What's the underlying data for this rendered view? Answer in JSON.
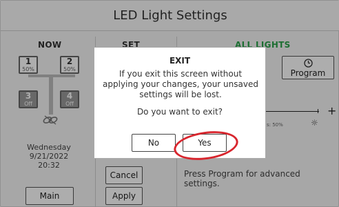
{
  "window": {
    "title": "LED Light Settings"
  },
  "now_panel": {
    "heading": "NOW",
    "lights": [
      {
        "number": "1",
        "status": "50%",
        "state": "on"
      },
      {
        "number": "2",
        "status": "50%",
        "state": "on"
      },
      {
        "number": "3",
        "status": "Off",
        "state": "off"
      },
      {
        "number": "4",
        "status": "Off",
        "state": "off"
      }
    ],
    "date": {
      "weekday": "Wednesday",
      "date": "9/21/2022",
      "time": "20:32"
    },
    "main_button": "Main"
  },
  "set_panel": {
    "heading": "SET",
    "cancel_button": "Cancel",
    "apply_button": "Apply"
  },
  "all_lights_panel": {
    "heading": "ALL LIGHTS",
    "program_button": "Program",
    "brightness_label": "s: 50%",
    "hint": "Press Program for advanced settings."
  },
  "dialog": {
    "title": "EXIT",
    "message": "If you exit this screen without applying your changes, your unsaved settings will be lost.",
    "question": "Do you want to exit?",
    "no_button": "No",
    "yes_button": "Yes"
  },
  "colors": {
    "accent_green": "#2aa34a",
    "annotation_red": "#d8262e"
  }
}
